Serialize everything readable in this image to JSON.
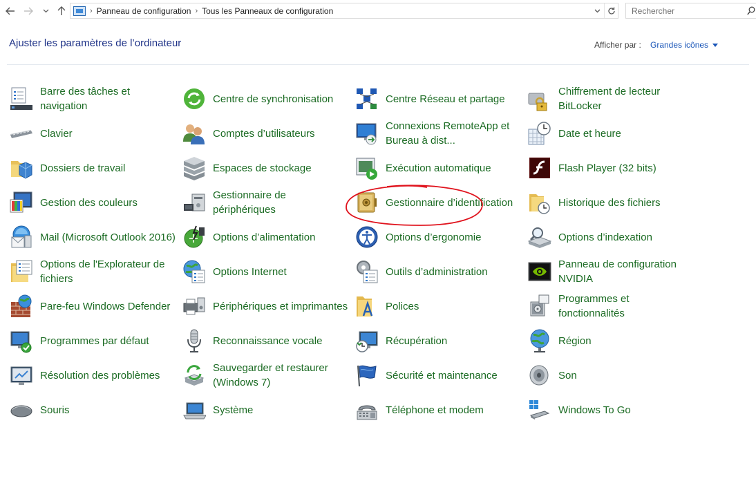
{
  "toolbar": {
    "back_icon": "back-arrow-icon",
    "forward_icon": "forward-arrow-icon",
    "recent_icon": "chevron-down-icon",
    "up_icon": "up-arrow-icon"
  },
  "address": {
    "crumbs": [
      "Panneau de configuration",
      "Tous les Panneaux de configuration"
    ]
  },
  "search": {
    "placeholder": "Rechercher"
  },
  "header": {
    "title": "Ajuster les paramètres de l’ordinateur",
    "view_by_label": "Afficher par :",
    "view_by_value": "Grandes icônes"
  },
  "items": [
    [
      "Barre des tâches et navigation",
      "Centre de synchronisation",
      "Centre Réseau et partage",
      "Chiffrement de lecteur BitLocker"
    ],
    [
      "Clavier",
      "Comptes d’utilisateurs",
      "Connexions RemoteApp et Bureau à dist...",
      "Date et heure"
    ],
    [
      "Dossiers de travail",
      "Espaces de stockage",
      "Exécution automatique",
      "Flash Player (32 bits)"
    ],
    [
      "Gestion des couleurs",
      "Gestionnaire de périphériques",
      "Gestionnaire d’identification",
      "Historique des fichiers"
    ],
    [
      "Mail (Microsoft Outlook 2016)",
      "Options d’alimentation",
      "Options d’ergonomie",
      "Options d’indexation"
    ],
    [
      "Options de l'Explorateur de fichiers",
      "Options Internet",
      "Outils d’administration",
      "Panneau de configuration NVIDIA"
    ],
    [
      "Pare-feu Windows Defender",
      "Périphériques et imprimantes",
      "Polices",
      "Programmes et fonctionnalités"
    ],
    [
      "Programmes par défaut",
      "Reconnaissance vocale",
      "Récupération",
      "Région"
    ],
    [
      "Résolution des problèmes",
      "Sauvegarder et restaurer (Windows 7)",
      "Sécurité et maintenance",
      "Son"
    ],
    [
      "Souris",
      "Système",
      "Téléphone et modem",
      "Windows To Go"
    ]
  ],
  "annotation": {
    "color": "#e0141e",
    "target": "Gestionnaire d’identification"
  }
}
